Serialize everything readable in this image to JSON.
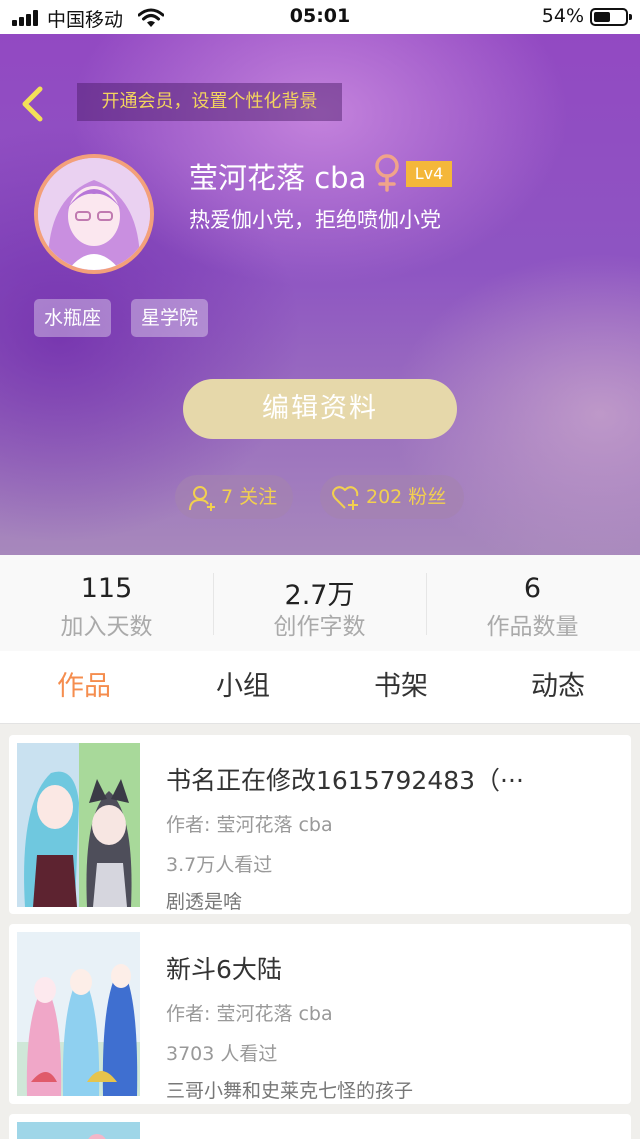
{
  "status_bar": {
    "carrier": "中国移动",
    "time": "05:01",
    "battery": "54%",
    "battery_level": 0.54,
    "icons": [
      "signal-icon",
      "wifi-icon",
      "battery-icon"
    ]
  },
  "header": {
    "vip_banner": "开通会员，设置个性化背景",
    "back_icon": "back-chevron-icon"
  },
  "profile": {
    "name": "莹河花落 cba",
    "gender_icon": "female-icon",
    "level": "Lv4",
    "bio": "热爱伽小党，拒绝喷伽小党",
    "tags": [
      "水瓶座",
      "星学院"
    ],
    "edit_button": "编辑资料",
    "follow_label": "7 关注",
    "fans_label": "202 粉丝"
  },
  "stats": [
    {
      "value": "115",
      "label": "加入天数"
    },
    {
      "value": "2.7万",
      "label": "创作字数"
    },
    {
      "value": "6",
      "label": "作品数量"
    }
  ],
  "tabs": [
    {
      "label": "作品",
      "active": true
    },
    {
      "label": "小组",
      "active": false
    },
    {
      "label": "书架",
      "active": false
    },
    {
      "label": "动态",
      "active": false
    }
  ],
  "works": [
    {
      "title": "书名正在修改1615792483（···",
      "author": "作者: 莹河花落 cba",
      "views": "3.7万人看过",
      "desc": "剧透是啥"
    },
    {
      "title": "新斗6大陆",
      "author": "作者: 莹河花落 cba",
      "views": "3703 人看过",
      "desc": "三哥小舞和史莱克七怪的孩子"
    },
    {
      "title": "",
      "author": "",
      "views": "",
      "desc": ""
    }
  ],
  "colors": {
    "accent": "#f58d4e",
    "gold": "#f3d35e",
    "edit_button": "#e6d8aa",
    "level_badge": "#f4b73a",
    "hero_purple": "#9249c2"
  }
}
